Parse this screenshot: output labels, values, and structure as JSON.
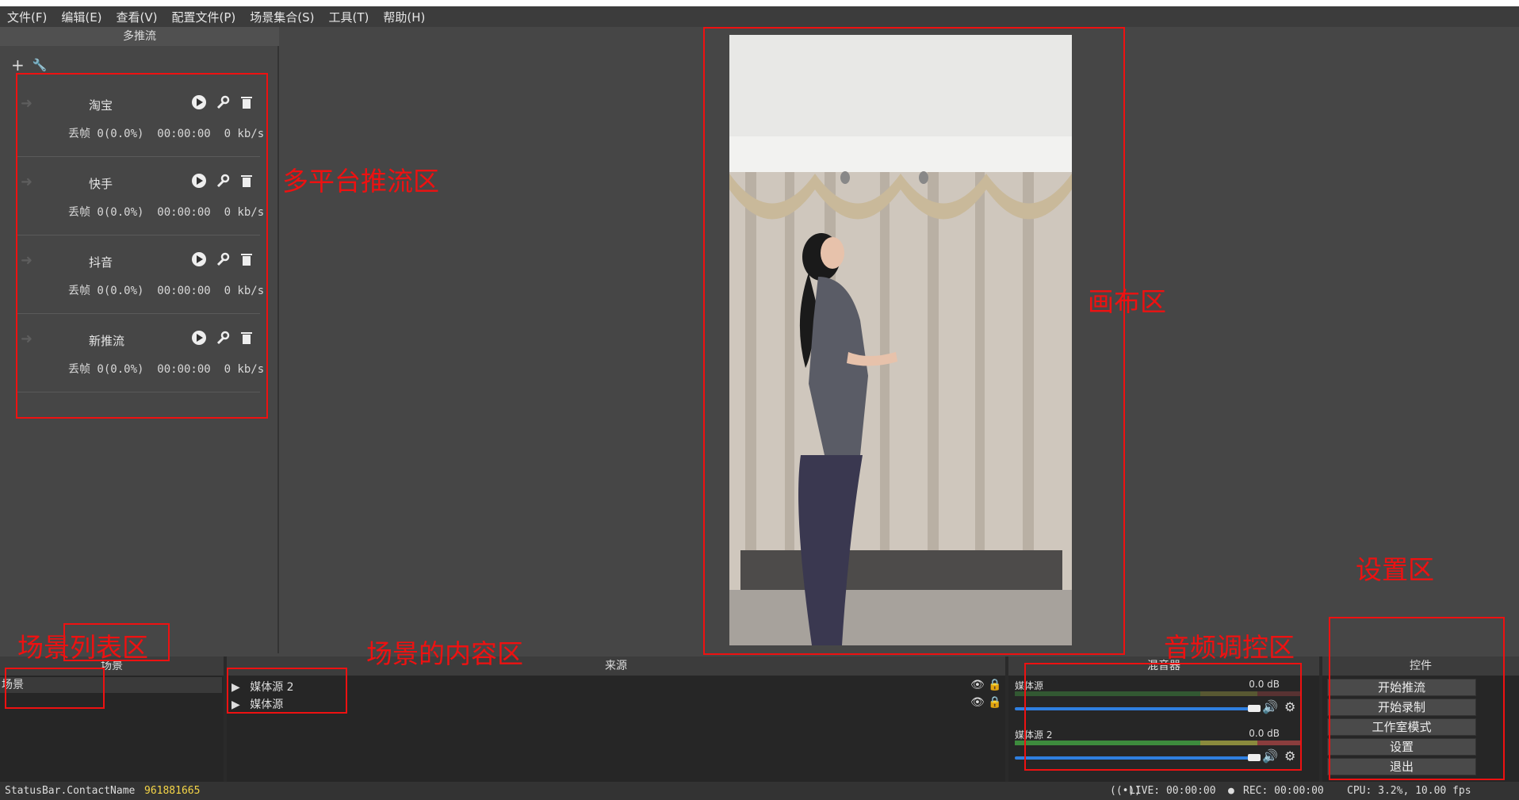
{
  "menu": [
    "文件(F)",
    "编辑(E)",
    "查看(V)",
    "配置文件(P)",
    "场景集合(S)",
    "工具(T)",
    "帮助(H)"
  ],
  "multistream": {
    "title": "多推流",
    "streams": [
      {
        "name": "淘宝",
        "stats": "丢帧 0(0.0%)  00:00:00  0 kb/s"
      },
      {
        "name": "快手",
        "stats": "丢帧 0(0.0%)  00:00:00  0 kb/s"
      },
      {
        "name": "抖音",
        "stats": "丢帧 0(0.0%)  00:00:00  0 kb/s"
      },
      {
        "name": "新推流",
        "stats": "丢帧 0(0.0%)  00:00:00  0 kb/s"
      }
    ]
  },
  "annotations": {
    "multistream_area": "多平台推流区",
    "canvas_area": "画布区",
    "scene_list_area": "场景列表区",
    "scene_content_area": "场景的内容区",
    "audio_area": "音频调控区",
    "settings_area": "设置区"
  },
  "scenes": {
    "title": "场景",
    "items": [
      "场景"
    ]
  },
  "sources": {
    "title": "来源",
    "items": [
      "媒体源 2",
      "媒体源"
    ]
  },
  "mixer": {
    "title": "混音器",
    "channels": [
      {
        "name": "媒体源",
        "db": "0.0 dB",
        "level": 0
      },
      {
        "name": "媒体源 2",
        "db": "0.0 dB",
        "level": 0.78
      }
    ],
    "scale": [
      "-60",
      "-55",
      "-50",
      "-45",
      "-40",
      "-35",
      "-30",
      "-25",
      "-20",
      "-15",
      "-10",
      "-5",
      "0"
    ]
  },
  "controls": {
    "title": "控件",
    "buttons": [
      "开始推流",
      "开始录制",
      "工作室模式",
      "设置",
      "退出"
    ]
  },
  "statusbar": {
    "contact_label": "StatusBar.ContactName",
    "contact_value": "961881665",
    "live": "LIVE: 00:00:00",
    "rec": "REC: 00:00:00",
    "cpu": "CPU: 3.2%, 10.00 fps"
  },
  "colors": {
    "annotation": "#ee1111",
    "contact": "#f5d547"
  }
}
